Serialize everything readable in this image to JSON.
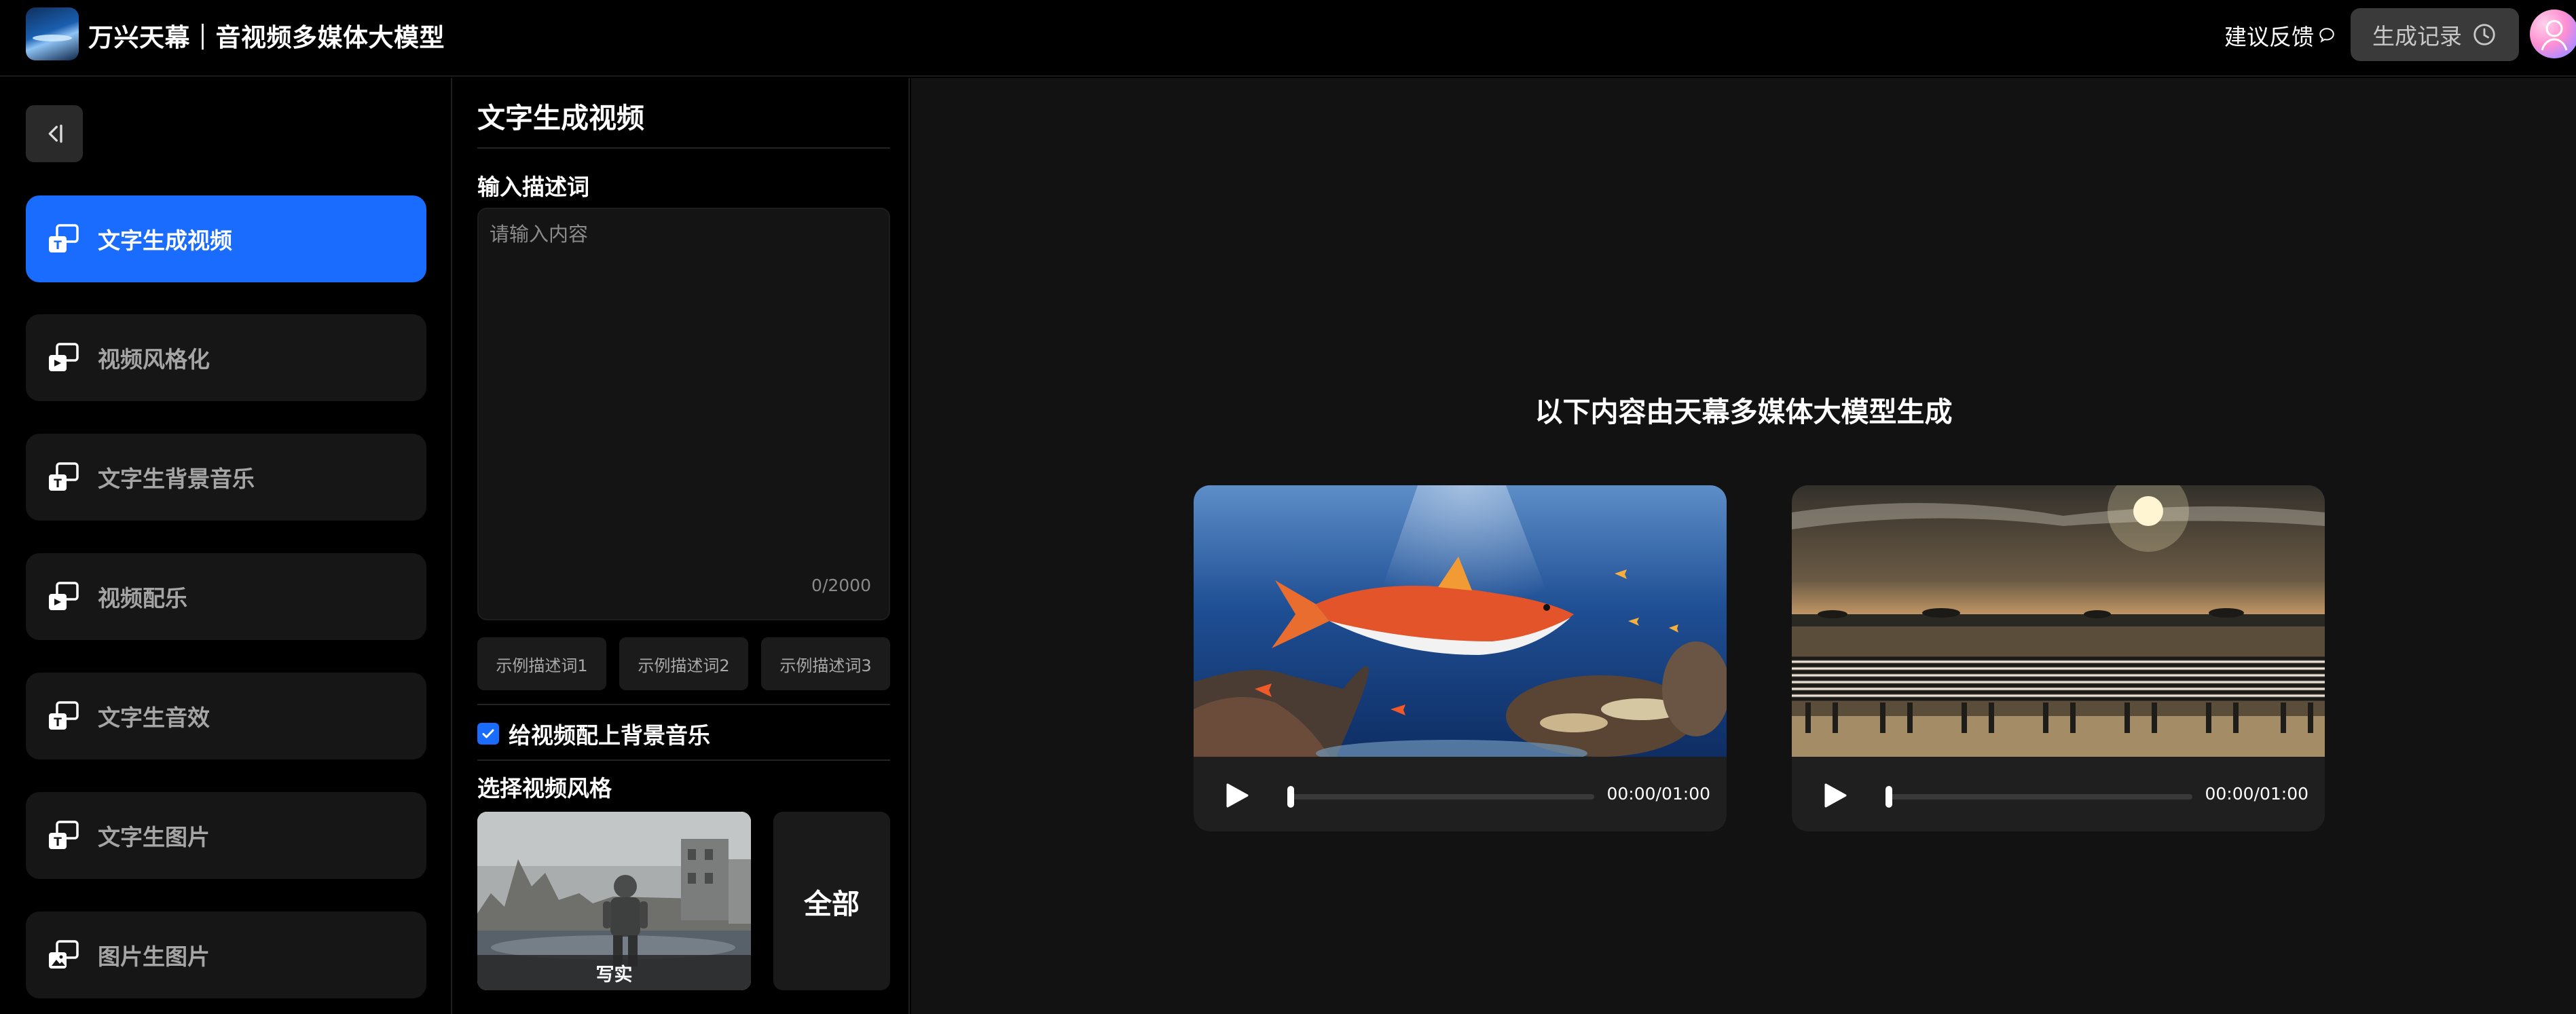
{
  "header": {
    "app_title": "万兴天幕｜音视频多媒体大模型",
    "feedback_label": "建议反馈",
    "history_label": "生成记录"
  },
  "sidebar": {
    "items": [
      {
        "label": "文字生成视频",
        "active": true,
        "icon": "text-to-video-icon"
      },
      {
        "label": "视频风格化",
        "active": false,
        "icon": "video-style-icon"
      },
      {
        "label": "文字生背景音乐",
        "active": false,
        "icon": "text-to-music-icon"
      },
      {
        "label": "视频配乐",
        "active": false,
        "icon": "video-music-icon"
      },
      {
        "label": "文字生音效",
        "active": false,
        "icon": "text-to-sfx-icon"
      },
      {
        "label": "文字生图片",
        "active": false,
        "icon": "text-to-image-icon"
      },
      {
        "label": "图片生图片",
        "active": false,
        "icon": "image-to-image-icon"
      }
    ]
  },
  "panel": {
    "title": "文字生成视频",
    "prompt_label": "输入描述词",
    "prompt_placeholder": "请输入内容",
    "prompt_value": "",
    "char_counter": "0/2000",
    "examples": [
      "示例描述词1",
      "示例描述词2",
      "示例描述词3"
    ],
    "bgm_checkbox_label": "给视频配上背景音乐",
    "bgm_checked": true,
    "style_label": "选择视频风格",
    "style_selected": "写实",
    "style_all_label": "全部"
  },
  "main": {
    "heading": "以下内容由天幕多媒体大模型生成",
    "videos": [
      {
        "time": "00:00/01:00",
        "progress": 0
      },
      {
        "time": "00:00/01:00",
        "progress": 0
      }
    ]
  },
  "colors": {
    "accent": "#1a6cff",
    "background": "#000000",
    "main_background": "#121212",
    "card": "#161616"
  }
}
